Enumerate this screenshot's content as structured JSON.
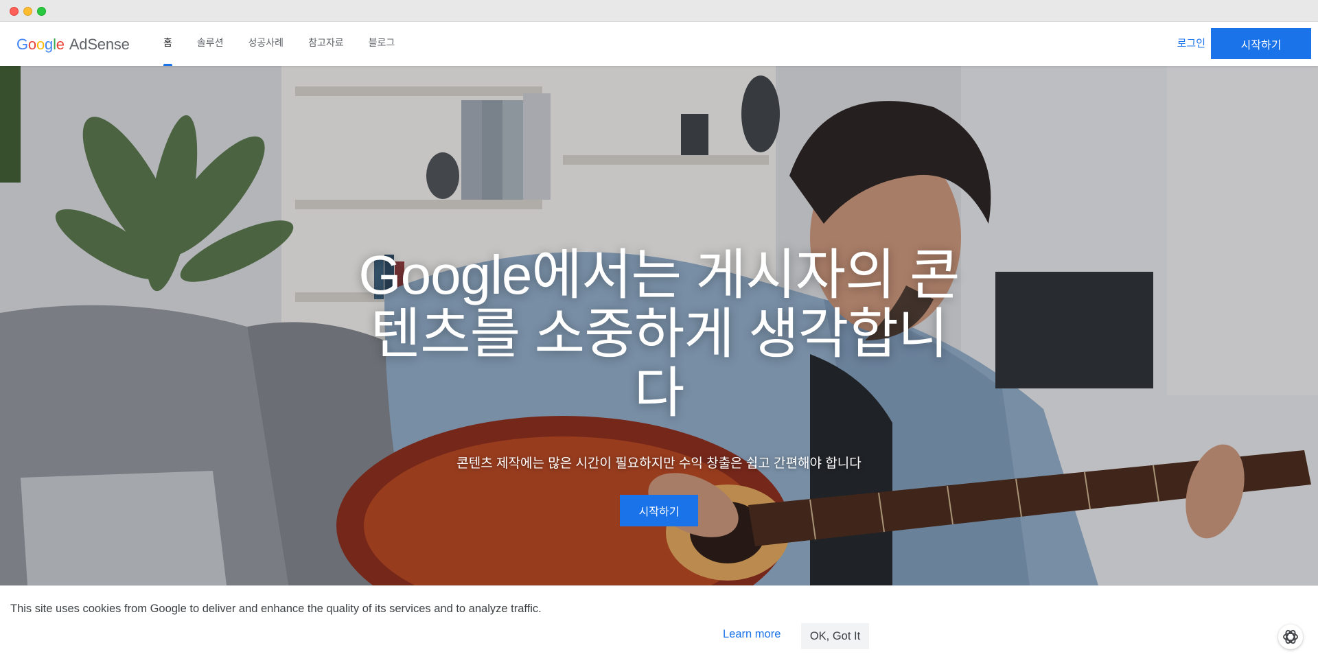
{
  "header": {
    "logo_google": [
      "G",
      "o",
      "o",
      "g",
      "l",
      "e"
    ],
    "logo_product": "AdSense",
    "nav": [
      {
        "label": "홈",
        "active": true
      },
      {
        "label": "솔루션",
        "active": false
      },
      {
        "label": "성공사례",
        "active": false
      },
      {
        "label": "참고자료",
        "active": false
      },
      {
        "label": "블로그",
        "active": false
      }
    ],
    "login_label": "로그인",
    "cta_label": "시작하기"
  },
  "hero": {
    "title": "Google에서는 게시자의 콘텐츠를 소중하게 생각합니다",
    "subtitle": "콘텐츠 제작에는 많은 시간이 필요하지만 수익 창출은 쉽고 간편해야 합니다",
    "cta_label": "시작하기",
    "image_icon": "man-playing-guitar-photo"
  },
  "cookie_bar": {
    "message": "This site uses cookies from Google to deliver and enhance the quality of its services and to analyze traffic.",
    "learn_more_label": "Learn more",
    "ok_label": "OK, Got It",
    "assistant_icon": "chat-assistant-icon"
  },
  "colors": {
    "accent": "#1a73e8",
    "google_blue": "#4285f4",
    "google_red": "#ea4335",
    "google_yellow": "#fbbc05",
    "google_green": "#34a853"
  }
}
